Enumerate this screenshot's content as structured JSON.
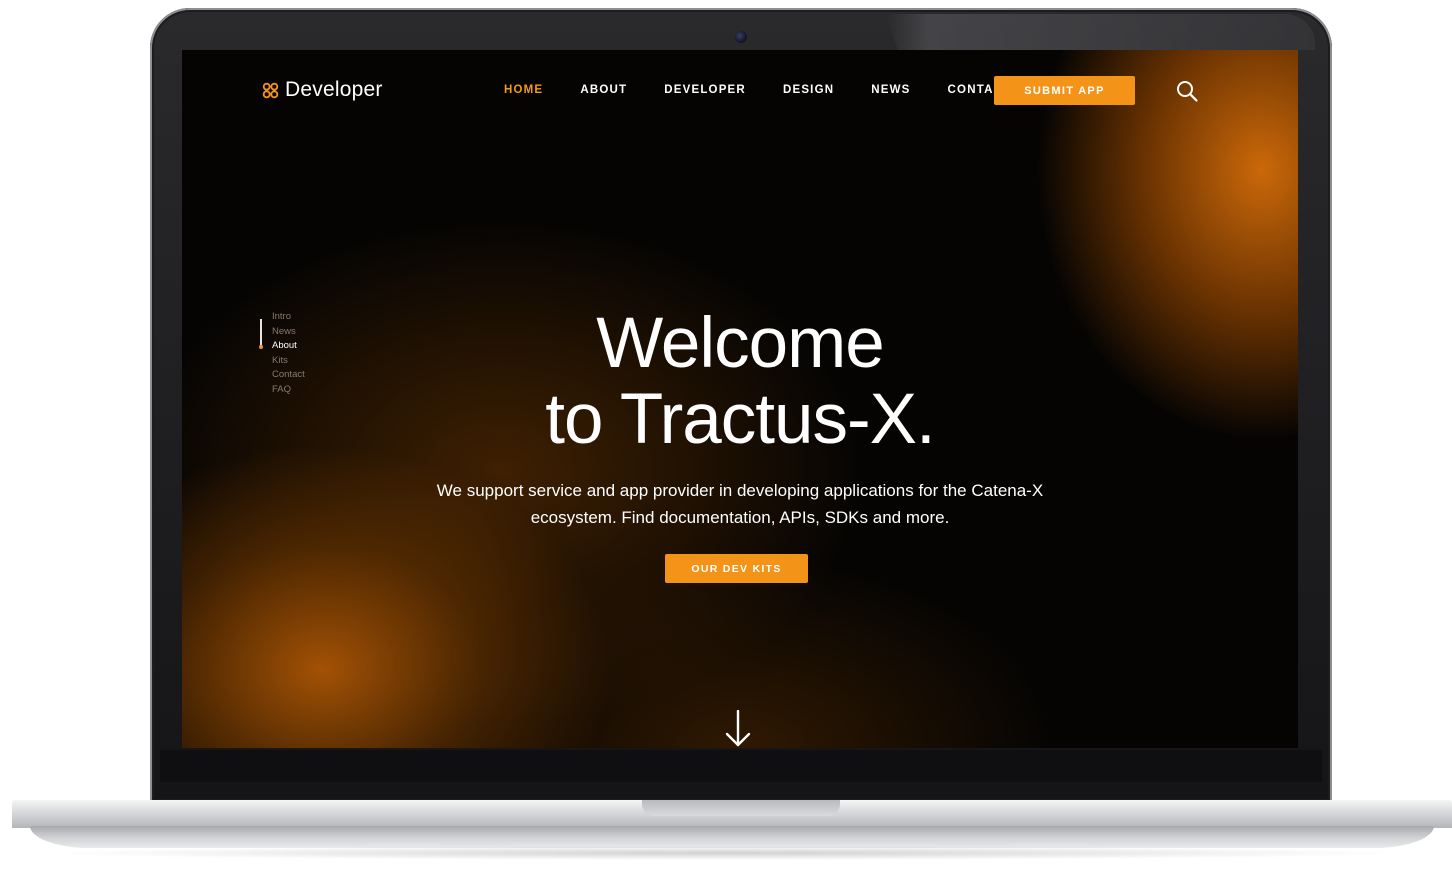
{
  "brand": {
    "name": "Developer",
    "icon": "catena-x-logo-icon"
  },
  "nav": {
    "items": [
      {
        "label": "HOME",
        "active": true
      },
      {
        "label": "ABOUT",
        "active": false
      },
      {
        "label": "DEVELOPER",
        "active": false
      },
      {
        "label": "DESIGN",
        "active": false
      },
      {
        "label": "NEWS",
        "active": false
      },
      {
        "label": "CONTACT",
        "active": false
      }
    ],
    "submit_label": "SUBMIT APP",
    "search_icon": "search-icon"
  },
  "sidenav": {
    "items": [
      {
        "label": "Intro",
        "active": false
      },
      {
        "label": "News",
        "active": false
      },
      {
        "label": "About",
        "active": true
      },
      {
        "label": "Kits",
        "active": false
      },
      {
        "label": "Contact",
        "active": false
      },
      {
        "label": "FAQ",
        "active": false
      }
    ]
  },
  "hero": {
    "title_line1": "Welcome",
    "title_line2": "to Tractus-X.",
    "subtitle": "We support service and app provider in developing applications for the Catena-X ecosystem. Find documentation, APIs, SDKs and more.",
    "cta_label": "OUR DEV KITS",
    "scroll_icon": "arrow-down-icon"
  },
  "colors": {
    "accent": "#f39419",
    "active_nav": "#f59a16",
    "background": "#050403"
  }
}
